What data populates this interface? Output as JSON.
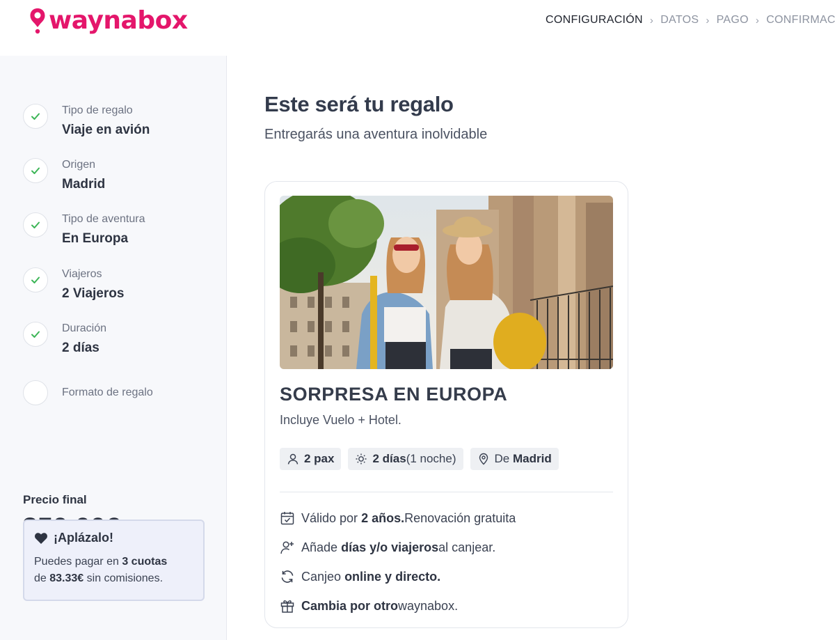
{
  "brand": {
    "name": "waynabox",
    "color": "#e4166b"
  },
  "steps": [
    {
      "label": "CONFIGURACIÓN",
      "active": true
    },
    {
      "label": "DATOS",
      "active": false
    },
    {
      "label": "PAGO",
      "active": false
    },
    {
      "label": "CONFIRMACIÓN",
      "active": false
    }
  ],
  "summary": [
    {
      "label": "Tipo de regalo",
      "value": "Viaje en avión",
      "done": true
    },
    {
      "label": "Origen",
      "value": "Madrid",
      "done": true
    },
    {
      "label": "Tipo de aventura",
      "value": "En Europa",
      "done": true
    },
    {
      "label": "Viajeros",
      "value": "2 Viajeros",
      "done": true
    },
    {
      "label": "Duración",
      "value": "2 días",
      "done": true
    },
    {
      "label": "Formato de regalo",
      "value": "",
      "done": false
    }
  ],
  "price": {
    "label": "Precio final",
    "value": "250.00€"
  },
  "aplazalo": {
    "title": "¡Aplázalo!",
    "line1_pre": "Puedes pagar en ",
    "line1_bold": "3 cuotas",
    "line2_pre": "de ",
    "line2_bold": "83.33€",
    "line2_post": " sin comisiones."
  },
  "main": {
    "title": "Este será tu regalo",
    "subtitle": "Entregarás una aventura inolvidable"
  },
  "card": {
    "title": "SORPRESA EN EUROPA",
    "subtitle": "Incluye Vuelo + Hotel.",
    "chips": [
      {
        "icon": "person-icon",
        "bold": "2 pax",
        "text": ""
      },
      {
        "icon": "sun-icon",
        "bold": "2 días",
        "text": " (1 noche)"
      },
      {
        "icon": "location-pin-icon",
        "pre": "De ",
        "bold": "Madrid"
      }
    ],
    "features": [
      {
        "icon": "calendar-check-icon",
        "pre": "Válido por ",
        "bold": "2 años.",
        "post": " Renovación gratuita"
      },
      {
        "icon": "add-user-icon",
        "pre": "Añade ",
        "bold": "días y/o viajeros",
        "post": " al canjear."
      },
      {
        "icon": "refresh-icon",
        "pre": "Canjeo ",
        "bold": "online y directo.",
        "post": ""
      },
      {
        "icon": "gift-icon",
        "pre": "",
        "bold": "Cambia por otro",
        "post": " waynabox."
      }
    ]
  },
  "colors": {
    "accent": "#e4166b",
    "check": "#3cb556",
    "text_dark": "#333b4c",
    "sidebar_bg": "#f7f8fb"
  }
}
